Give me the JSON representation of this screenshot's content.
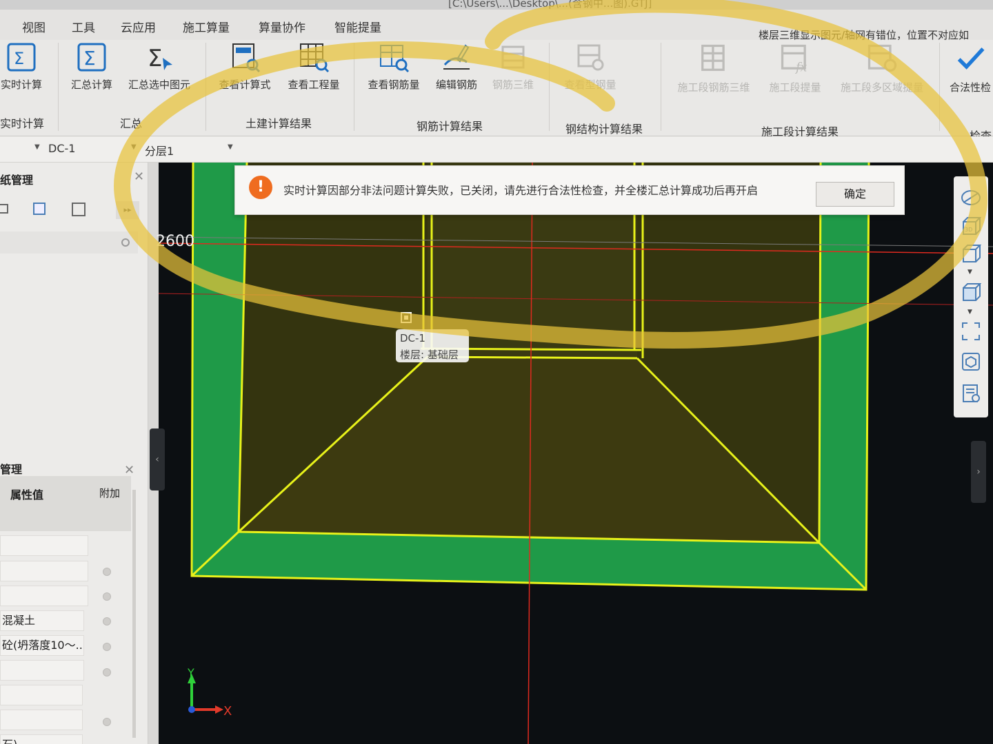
{
  "window": {
    "title_fragment": "[C:\\Users\\...\\Desktop\\...(含钢中...图).GTJ]"
  },
  "menu": {
    "items": [
      "视图",
      "工具",
      "云应用",
      "施工算量",
      "算量协作",
      "智能提量"
    ],
    "hint": "楼层三维显示图元/轴网有错位，位置不对应如"
  },
  "ribbon": {
    "buttons": [
      {
        "label": "实时计算",
        "icon": "realtime-calc-icon",
        "enabled": true
      },
      {
        "label": "汇总计算",
        "icon": "sigma-icon",
        "enabled": true
      },
      {
        "label": "汇总选中图元",
        "icon": "sigma-select-icon",
        "enabled": true
      },
      {
        "label": "查看计算式",
        "icon": "view-formula-icon",
        "enabled": true
      },
      {
        "label": "查看工程量",
        "icon": "view-quantity-icon",
        "enabled": true
      },
      {
        "label": "查看钢筋量",
        "icon": "view-rebar-icon",
        "enabled": true
      },
      {
        "label": "编辑钢筋",
        "icon": "edit-rebar-icon",
        "enabled": true
      },
      {
        "label": "钢筋三维",
        "icon": "rebar-3d-icon",
        "enabled": false
      },
      {
        "label": "查看型钢量",
        "icon": "view-steel-icon",
        "enabled": false
      },
      {
        "label": "施工段钢筋三维",
        "icon": "stage-rebar-3d-icon",
        "enabled": false
      },
      {
        "label": "施工段提量",
        "icon": "stage-quantity-icon",
        "enabled": false
      },
      {
        "label": "施工段多区域提量",
        "icon": "stage-multi-area-icon",
        "enabled": false
      },
      {
        "label": "合法性检",
        "icon": "checkmark-icon",
        "enabled": true
      }
    ],
    "groups": [
      "实时计算",
      "汇总",
      "土建计算结果",
      "钢筋计算结果",
      "钢结构计算结果",
      "施工段计算结果",
      "检查"
    ]
  },
  "layerbar": {
    "component": "DC-1",
    "layer": "分层1"
  },
  "left_panel": {
    "top_title": "纸管理",
    "bottom_title": "管理",
    "columns": [
      "属性值",
      "附加"
    ],
    "rows": [
      "",
      "",
      "",
      "混凝土",
      "砼(坍落度10～...",
      "",
      "",
      "",
      "石)"
    ]
  },
  "viewport": {
    "dimension": "2600"
  },
  "notice": {
    "icon": "!",
    "message": "实时计算因部分非法问题计算失败，已关闭，请先进行合法性检查，并全楼汇总计算成功后再开启",
    "button": "确定"
  },
  "tooltip": {
    "name": "DC-1",
    "floor": "楼层: 基础层"
  },
  "axis": {
    "y": "Y",
    "x": "X"
  },
  "colors": {
    "accent": "#1f7ad8",
    "warning": "#ef6c1f",
    "outline": "#e8f21a",
    "green_face": "#1f9a48",
    "marker": "#e7c23a"
  }
}
